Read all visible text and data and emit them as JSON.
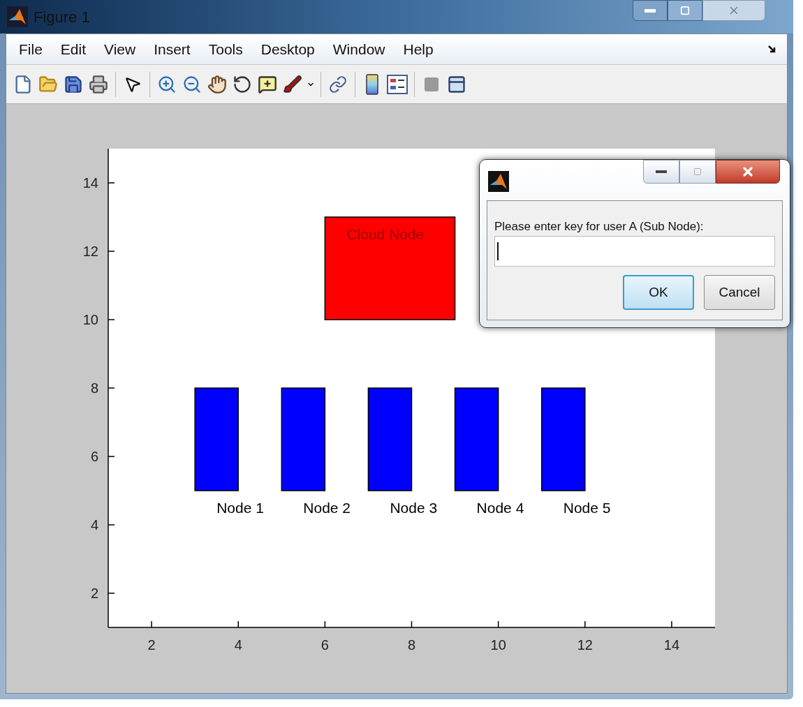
{
  "window": {
    "title": "Figure 1"
  },
  "menu": [
    "File",
    "Edit",
    "View",
    "Insert",
    "Tools",
    "Desktop",
    "Window",
    "Help"
  ],
  "plot": {
    "xticks": [
      "2",
      "4",
      "6",
      "8",
      "10",
      "12",
      "14"
    ],
    "yticks": [
      "14",
      "12",
      "10",
      "8",
      "6",
      "4",
      "2"
    ],
    "patches": [
      {
        "kind": "cloud",
        "label": "Cloud Node",
        "color": "#ff0000"
      },
      {
        "kind": "node",
        "label": "Node 1",
        "color": "#0000ff"
      },
      {
        "kind": "node",
        "label": "Node 2",
        "color": "#0000ff"
      },
      {
        "kind": "node",
        "label": "Node 3",
        "color": "#0000ff"
      },
      {
        "kind": "node",
        "label": "Node 4",
        "color": "#0000ff"
      },
      {
        "kind": "node",
        "label": "Node 5",
        "color": "#0000ff"
      }
    ]
  },
  "dialog": {
    "prompt": "Please enter key for user A (Sub Node):",
    "buttons": [
      {
        "label": "OK",
        "selected": true
      },
      {
        "label": "Cancel",
        "selected": false
      }
    ]
  }
}
